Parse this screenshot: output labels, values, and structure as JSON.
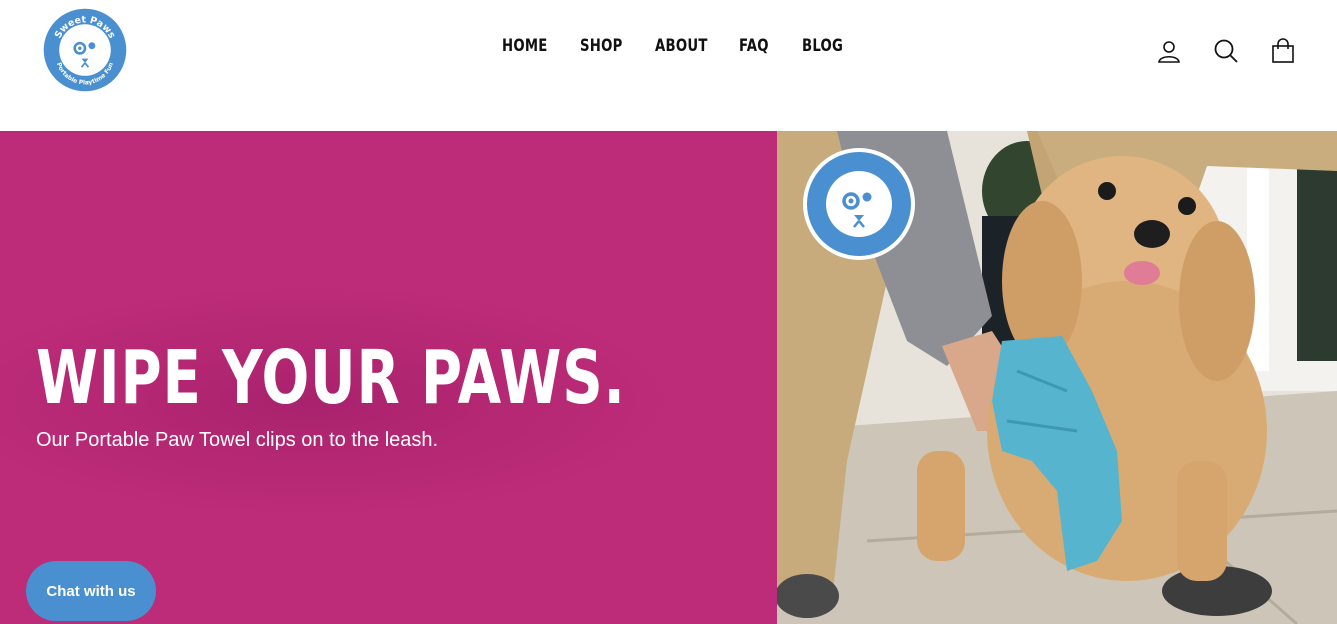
{
  "brand": {
    "name": "Sweet Paws",
    "tagline": "Portable Playtime Fun",
    "primary_color": "#4a8fd0",
    "hero_color": "#bd2c79"
  },
  "nav": {
    "items": [
      {
        "label": "HOME"
      },
      {
        "label": "SHOP"
      },
      {
        "label": "ABOUT"
      },
      {
        "label": "FAQ"
      },
      {
        "label": "BLOG"
      }
    ]
  },
  "header_icons": [
    "account-icon",
    "search-icon",
    "cart-icon"
  ],
  "hero": {
    "title": "WIPE YOUR PAWS.",
    "subtitle": "Our Portable Paw Towel clips on to the leash."
  },
  "chat": {
    "label": "Chat with us"
  }
}
